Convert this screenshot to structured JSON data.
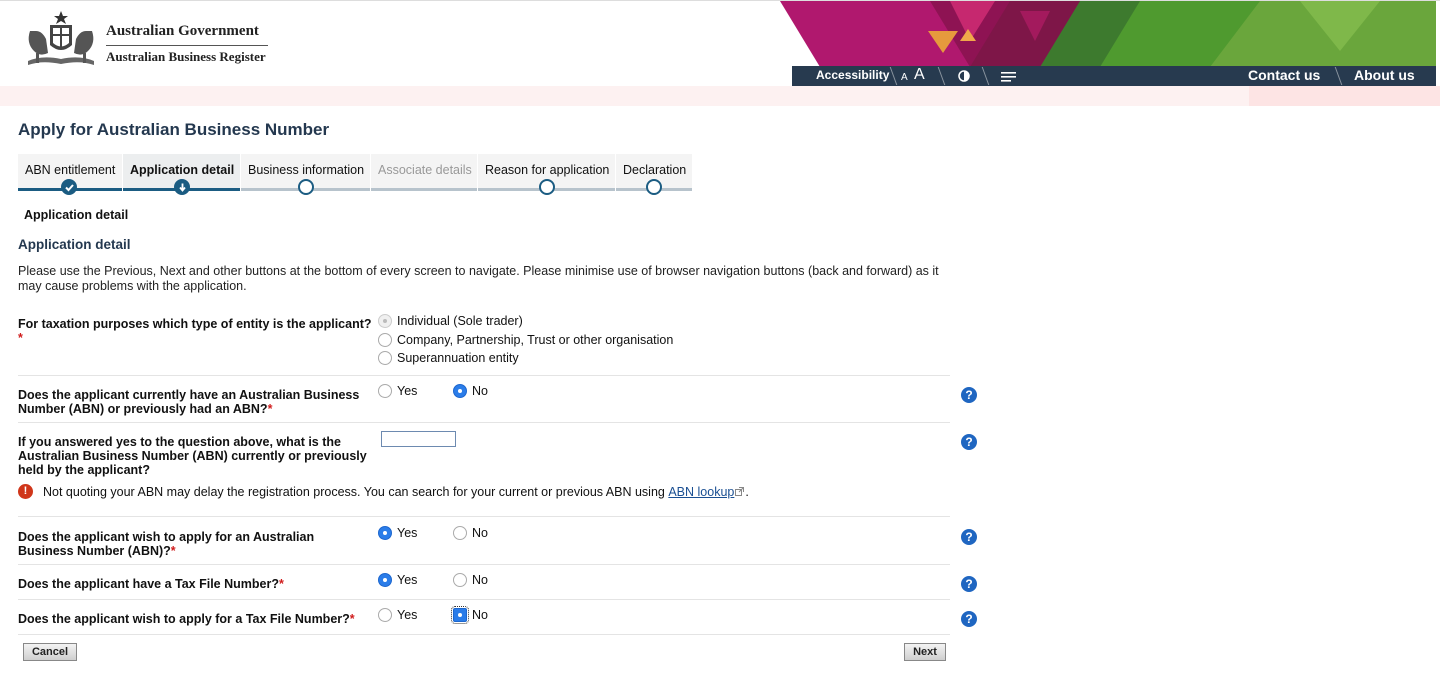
{
  "header": {
    "gov_title": "Australian Government",
    "gov_subtitle": "Australian Business Register",
    "accessibility_label": "Accessibility",
    "font_small": "A",
    "font_large": "A",
    "contrast_icon": "contrast-icon",
    "menu_icon": "menu-icon",
    "contact_label": "Contact us",
    "about_label": "About us"
  },
  "page": {
    "title": "Apply for Australian Business Number"
  },
  "tabs": [
    {
      "label": "ABN entitlement",
      "state": "done"
    },
    {
      "label": "Application detail",
      "state": "current"
    },
    {
      "label": "Business information",
      "state": "todo"
    },
    {
      "label": "Associate details",
      "state": "disabled"
    },
    {
      "label": "Reason for application",
      "state": "todo"
    },
    {
      "label": "Declaration",
      "state": "todo"
    }
  ],
  "breadcrumb": "Application detail",
  "section_title": "Application detail",
  "intro": "Please use the Previous, Next and other buttons at the bottom of every screen to navigate. Please minimise use of browser navigation buttons (back and forward) as it may cause problems with the application.",
  "questions": {
    "entity_type": {
      "label": "For taxation purposes which type of entity is the applicant?",
      "required": "*",
      "options": [
        "Individual (Sole trader)",
        "Company, Partnership, Trust or other organisation",
        "Superannuation entity"
      ],
      "selected": "Individual (Sole trader)"
    },
    "has_abn": {
      "label": "Does the applicant currently have an Australian Business Number (ABN) or previously had an ABN?",
      "required": "*",
      "yes": "Yes",
      "no": "No",
      "selected": "No"
    },
    "abn_number": {
      "label": "If you answered yes to the question above, what is the Australian Business Number (ABN) currently or previously held by the applicant?",
      "value": ""
    },
    "warning": {
      "text": "Not quoting your ABN may delay the registration process. You can search for your current or previous ABN using",
      "link": "ABN lookup",
      "suffix": "."
    },
    "apply_abn": {
      "label": "Does the applicant wish to apply for an Australian Business Number (ABN)?",
      "required": "*",
      "yes": "Yes",
      "no": "No",
      "selected": "Yes"
    },
    "has_tfn": {
      "label": "Does the applicant have a Tax File Number?",
      "required": "*",
      "yes": "Yes",
      "no": "No",
      "selected": "Yes"
    },
    "apply_tfn": {
      "label": "Does the applicant wish to apply for a Tax File Number?",
      "required": "*",
      "yes": "Yes",
      "no": "No",
      "selected": "No"
    }
  },
  "help_symbol": "?",
  "warn_symbol": "!",
  "buttons": {
    "cancel": "Cancel",
    "next": "Next"
  },
  "colors": {
    "navy": "#273a4f",
    "title": "#24384f",
    "accent": "#1b5c82",
    "magenta": "#b0186e",
    "green": "#4c9a2a"
  }
}
